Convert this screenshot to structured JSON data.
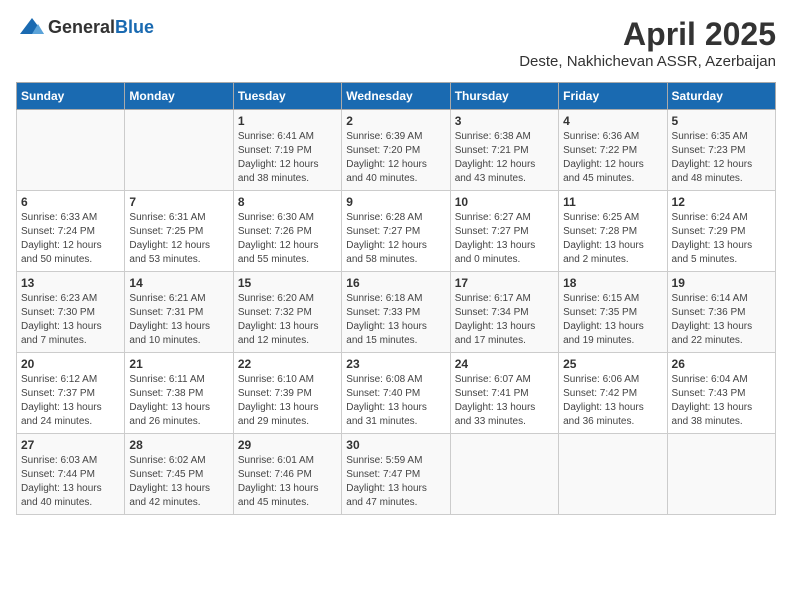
{
  "header": {
    "logo_general": "General",
    "logo_blue": "Blue",
    "month": "April 2025",
    "location": "Deste, Nakhichevan ASSR, Azerbaijan"
  },
  "columns": [
    "Sunday",
    "Monday",
    "Tuesday",
    "Wednesday",
    "Thursday",
    "Friday",
    "Saturday"
  ],
  "weeks": [
    [
      {
        "day": "",
        "info": ""
      },
      {
        "day": "",
        "info": ""
      },
      {
        "day": "1",
        "info": "Sunrise: 6:41 AM\nSunset: 7:19 PM\nDaylight: 12 hours\nand 38 minutes."
      },
      {
        "day": "2",
        "info": "Sunrise: 6:39 AM\nSunset: 7:20 PM\nDaylight: 12 hours\nand 40 minutes."
      },
      {
        "day": "3",
        "info": "Sunrise: 6:38 AM\nSunset: 7:21 PM\nDaylight: 12 hours\nand 43 minutes."
      },
      {
        "day": "4",
        "info": "Sunrise: 6:36 AM\nSunset: 7:22 PM\nDaylight: 12 hours\nand 45 minutes."
      },
      {
        "day": "5",
        "info": "Sunrise: 6:35 AM\nSunset: 7:23 PM\nDaylight: 12 hours\nand 48 minutes."
      }
    ],
    [
      {
        "day": "6",
        "info": "Sunrise: 6:33 AM\nSunset: 7:24 PM\nDaylight: 12 hours\nand 50 minutes."
      },
      {
        "day": "7",
        "info": "Sunrise: 6:31 AM\nSunset: 7:25 PM\nDaylight: 12 hours\nand 53 minutes."
      },
      {
        "day": "8",
        "info": "Sunrise: 6:30 AM\nSunset: 7:26 PM\nDaylight: 12 hours\nand 55 minutes."
      },
      {
        "day": "9",
        "info": "Sunrise: 6:28 AM\nSunset: 7:27 PM\nDaylight: 12 hours\nand 58 minutes."
      },
      {
        "day": "10",
        "info": "Sunrise: 6:27 AM\nSunset: 7:27 PM\nDaylight: 13 hours\nand 0 minutes."
      },
      {
        "day": "11",
        "info": "Sunrise: 6:25 AM\nSunset: 7:28 PM\nDaylight: 13 hours\nand 2 minutes."
      },
      {
        "day": "12",
        "info": "Sunrise: 6:24 AM\nSunset: 7:29 PM\nDaylight: 13 hours\nand 5 minutes."
      }
    ],
    [
      {
        "day": "13",
        "info": "Sunrise: 6:23 AM\nSunset: 7:30 PM\nDaylight: 13 hours\nand 7 minutes."
      },
      {
        "day": "14",
        "info": "Sunrise: 6:21 AM\nSunset: 7:31 PM\nDaylight: 13 hours\nand 10 minutes."
      },
      {
        "day": "15",
        "info": "Sunrise: 6:20 AM\nSunset: 7:32 PM\nDaylight: 13 hours\nand 12 minutes."
      },
      {
        "day": "16",
        "info": "Sunrise: 6:18 AM\nSunset: 7:33 PM\nDaylight: 13 hours\nand 15 minutes."
      },
      {
        "day": "17",
        "info": "Sunrise: 6:17 AM\nSunset: 7:34 PM\nDaylight: 13 hours\nand 17 minutes."
      },
      {
        "day": "18",
        "info": "Sunrise: 6:15 AM\nSunset: 7:35 PM\nDaylight: 13 hours\nand 19 minutes."
      },
      {
        "day": "19",
        "info": "Sunrise: 6:14 AM\nSunset: 7:36 PM\nDaylight: 13 hours\nand 22 minutes."
      }
    ],
    [
      {
        "day": "20",
        "info": "Sunrise: 6:12 AM\nSunset: 7:37 PM\nDaylight: 13 hours\nand 24 minutes."
      },
      {
        "day": "21",
        "info": "Sunrise: 6:11 AM\nSunset: 7:38 PM\nDaylight: 13 hours\nand 26 minutes."
      },
      {
        "day": "22",
        "info": "Sunrise: 6:10 AM\nSunset: 7:39 PM\nDaylight: 13 hours\nand 29 minutes."
      },
      {
        "day": "23",
        "info": "Sunrise: 6:08 AM\nSunset: 7:40 PM\nDaylight: 13 hours\nand 31 minutes."
      },
      {
        "day": "24",
        "info": "Sunrise: 6:07 AM\nSunset: 7:41 PM\nDaylight: 13 hours\nand 33 minutes."
      },
      {
        "day": "25",
        "info": "Sunrise: 6:06 AM\nSunset: 7:42 PM\nDaylight: 13 hours\nand 36 minutes."
      },
      {
        "day": "26",
        "info": "Sunrise: 6:04 AM\nSunset: 7:43 PM\nDaylight: 13 hours\nand 38 minutes."
      }
    ],
    [
      {
        "day": "27",
        "info": "Sunrise: 6:03 AM\nSunset: 7:44 PM\nDaylight: 13 hours\nand 40 minutes."
      },
      {
        "day": "28",
        "info": "Sunrise: 6:02 AM\nSunset: 7:45 PM\nDaylight: 13 hours\nand 42 minutes."
      },
      {
        "day": "29",
        "info": "Sunrise: 6:01 AM\nSunset: 7:46 PM\nDaylight: 13 hours\nand 45 minutes."
      },
      {
        "day": "30",
        "info": "Sunrise: 5:59 AM\nSunset: 7:47 PM\nDaylight: 13 hours\nand 47 minutes."
      },
      {
        "day": "",
        "info": ""
      },
      {
        "day": "",
        "info": ""
      },
      {
        "day": "",
        "info": ""
      }
    ]
  ]
}
